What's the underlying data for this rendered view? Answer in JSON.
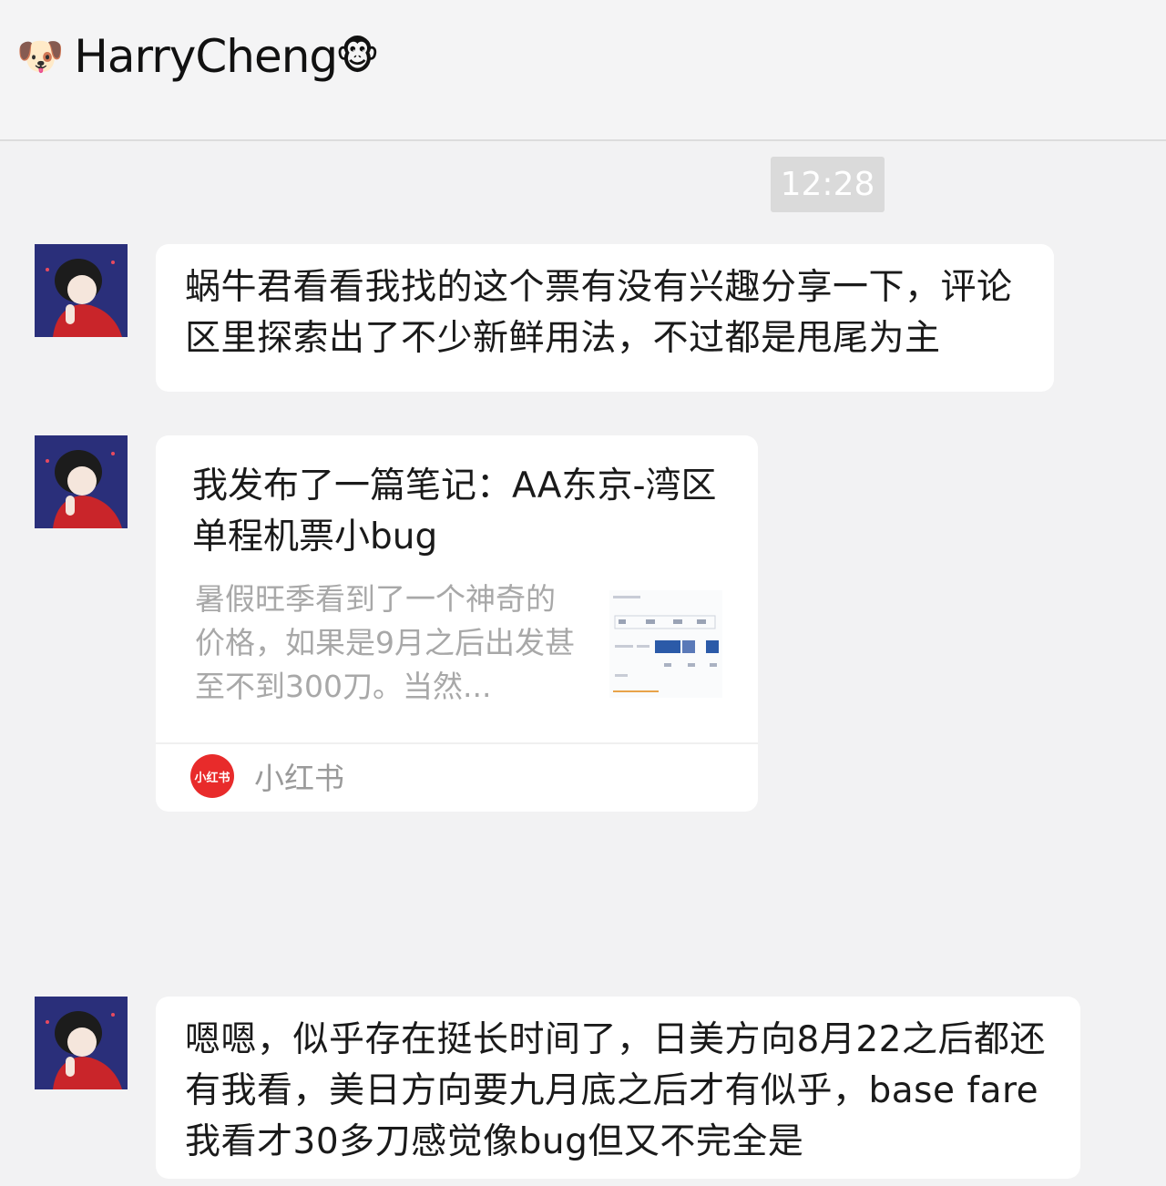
{
  "header": {
    "left_emoji": "🐶",
    "name": "HarryCheng",
    "right_emoji": "🐵"
  },
  "timestamp": "12:28",
  "messages": [
    {
      "text": "蜗牛君看看我找的这个票有没有兴趣分享一下，评论区里探索出了不少新鲜用法，不过都是甩尾为主"
    },
    {
      "card": {
        "title": "我发布了一篇笔记：AA东京-湾区单程机票小bug",
        "description": "暑假旺季看到了一个神奇的价格，如果是9月之后出发甚至不到300刀。当然...",
        "source_logo_text": "小红书",
        "source_label": "小红书"
      }
    },
    {
      "text": "嗯嗯，似乎存在挺长时间了，日美方向8月22之后都还有我看，美日方向要九月底之后才有似乎，base fare我看才30多刀感觉像bug但又不完全是"
    }
  ],
  "colors": {
    "background": "#f2f2f3",
    "bubble": "#ffffff",
    "avatar_bg": "#2a2f7a",
    "xhs_red": "#e82b2b"
  }
}
